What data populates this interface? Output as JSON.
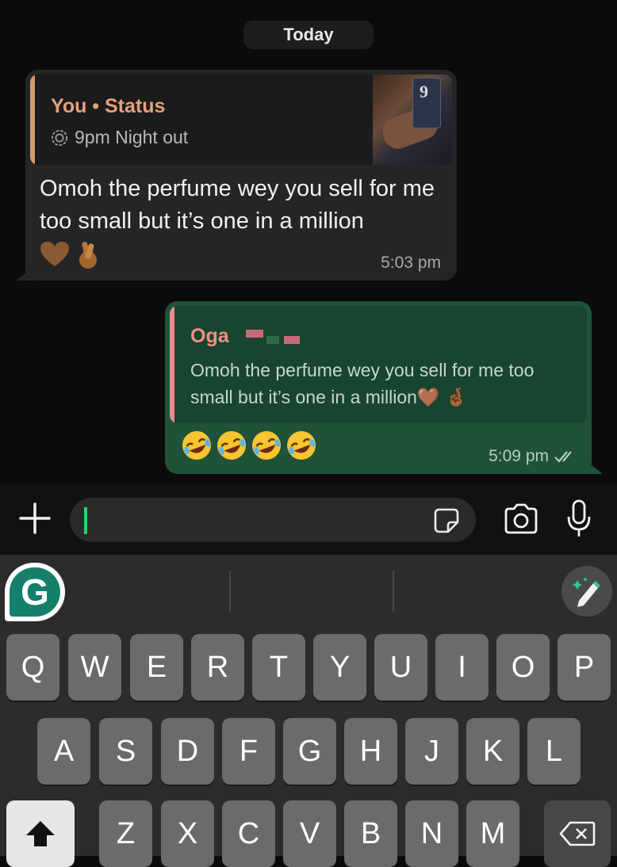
{
  "date_separator": "Today",
  "incoming": {
    "quote_title": "You • Status",
    "quote_subtitle": "9pm Night out",
    "thumbnail_number": "9",
    "text": "Omoh the perfume wey you sell for me too small but it’s one in a million",
    "emojis": [
      "🤎",
      "🤞🏾"
    ],
    "time": "5:03 pm"
  },
  "outgoing": {
    "reply_name": "Oga",
    "reply_text": "Omoh the perfume wey you sell for me too small but it’s one in a million🤎 🤞🏾",
    "emojis": [
      "🤣",
      "🤣",
      "🤣",
      "🤣"
    ],
    "time": "5:09 pm",
    "status_icon": "double-check-icon"
  },
  "composer": {
    "placeholder": "",
    "icons": [
      "plus-icon",
      "sticker-icon",
      "camera-icon",
      "microphone-icon"
    ]
  },
  "keyboard": {
    "logo_letter": "G",
    "row1": [
      "Q",
      "W",
      "E",
      "R",
      "T",
      "Y",
      "U",
      "I",
      "O",
      "P"
    ],
    "row2": [
      "A",
      "S",
      "D",
      "F",
      "G",
      "H",
      "J",
      "K",
      "L"
    ],
    "row3": [
      "Z",
      "X",
      "C",
      "V",
      "B",
      "N",
      "M"
    ]
  },
  "colors": {
    "incoming_bubble": "#252526",
    "outgoing_bubble": "#1f5239",
    "quote_accent": "#d59a74",
    "reply_accent": "#e88b8d",
    "caret": "#25d366"
  }
}
